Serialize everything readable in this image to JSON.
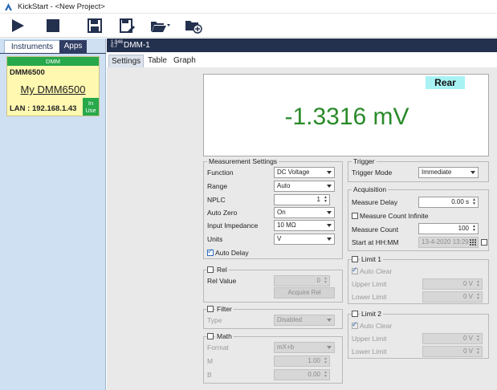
{
  "window": {
    "title": "KickStart - <New Project>"
  },
  "toolbar": {
    "buttons": [
      "play-icon",
      "stop-icon",
      "save-icon",
      "save-as-icon",
      "open-folder-icon",
      "add-folder-icon"
    ]
  },
  "left_panel": {
    "tabs": [
      "Instruments",
      "Apps"
    ],
    "card": {
      "header": "DMM",
      "model": "DMM6500",
      "nickname": "My DMM6500",
      "lan": "LAN : 192.168.1.43",
      "in_use": [
        "In",
        "Use"
      ]
    }
  },
  "instrument_tab": {
    "resolution": [
      "1.946",
      "0.7"
    ],
    "label": "DMM-1"
  },
  "sub_tabs": [
    "Settings",
    "Table",
    "Graph"
  ],
  "display": {
    "terminal": "Rear",
    "reading": "-1.3316 mV"
  },
  "measurement_settings": {
    "title": "Measurement Settings",
    "function": {
      "label": "Function",
      "value": "DC Voltage"
    },
    "range": {
      "label": "Range",
      "value": "Auto"
    },
    "nplc": {
      "label": "NPLC",
      "value": "1"
    },
    "auto_zero": {
      "label": "Auto Zero",
      "value": "On"
    },
    "input_impedance": {
      "label": "Input Impedance",
      "value": "10 MΩ"
    },
    "units": {
      "label": "Units",
      "value": "V"
    },
    "auto_delay": {
      "label": "Auto Delay",
      "checked": true
    }
  },
  "rel": {
    "title": "Rel",
    "value_label": "Rel Value",
    "value": "0",
    "button": "Acquire Rel"
  },
  "filter": {
    "title": "Filter",
    "type_label": "Type",
    "type_value": "Disabled"
  },
  "math": {
    "title": "Math",
    "format_label": "Format",
    "format_value": "mX+b",
    "m_label": "M",
    "m_value": "1.00",
    "b_label": "B",
    "b_value": "0.00"
  },
  "trigger": {
    "title": "Trigger",
    "mode_label": "Trigger Mode",
    "mode_value": "Immediate"
  },
  "acquisition": {
    "title": "Acquisition",
    "delay_label": "Measure Delay",
    "delay_value": "0.00 s",
    "infinite_label": "Measure Count Infinite",
    "count_label": "Measure Count",
    "count_value": "100",
    "start_label": "Start at HH:MM",
    "start_value": "13-4-2020 13:29"
  },
  "limit1": {
    "title": "Limit 1",
    "auto_clear": "Auto Clear",
    "upper_label": "Upper Limit",
    "upper_value": "0 V",
    "lower_label": "Lower Limit",
    "lower_value": "0 V"
  },
  "limit2": {
    "title": "Limit 2",
    "auto_clear": "Auto Clear",
    "upper_label": "Upper Limit",
    "upper_value": "0 V",
    "lower_label": "Lower Limit",
    "lower_value": "0 V"
  },
  "colors": {
    "brand_navy": "#23304e",
    "reading_green": "#2a8a2a",
    "in_use_green": "#27a84a",
    "card_yellow": "#fff8b0",
    "terminal_cyan": "#a8f2f4"
  }
}
